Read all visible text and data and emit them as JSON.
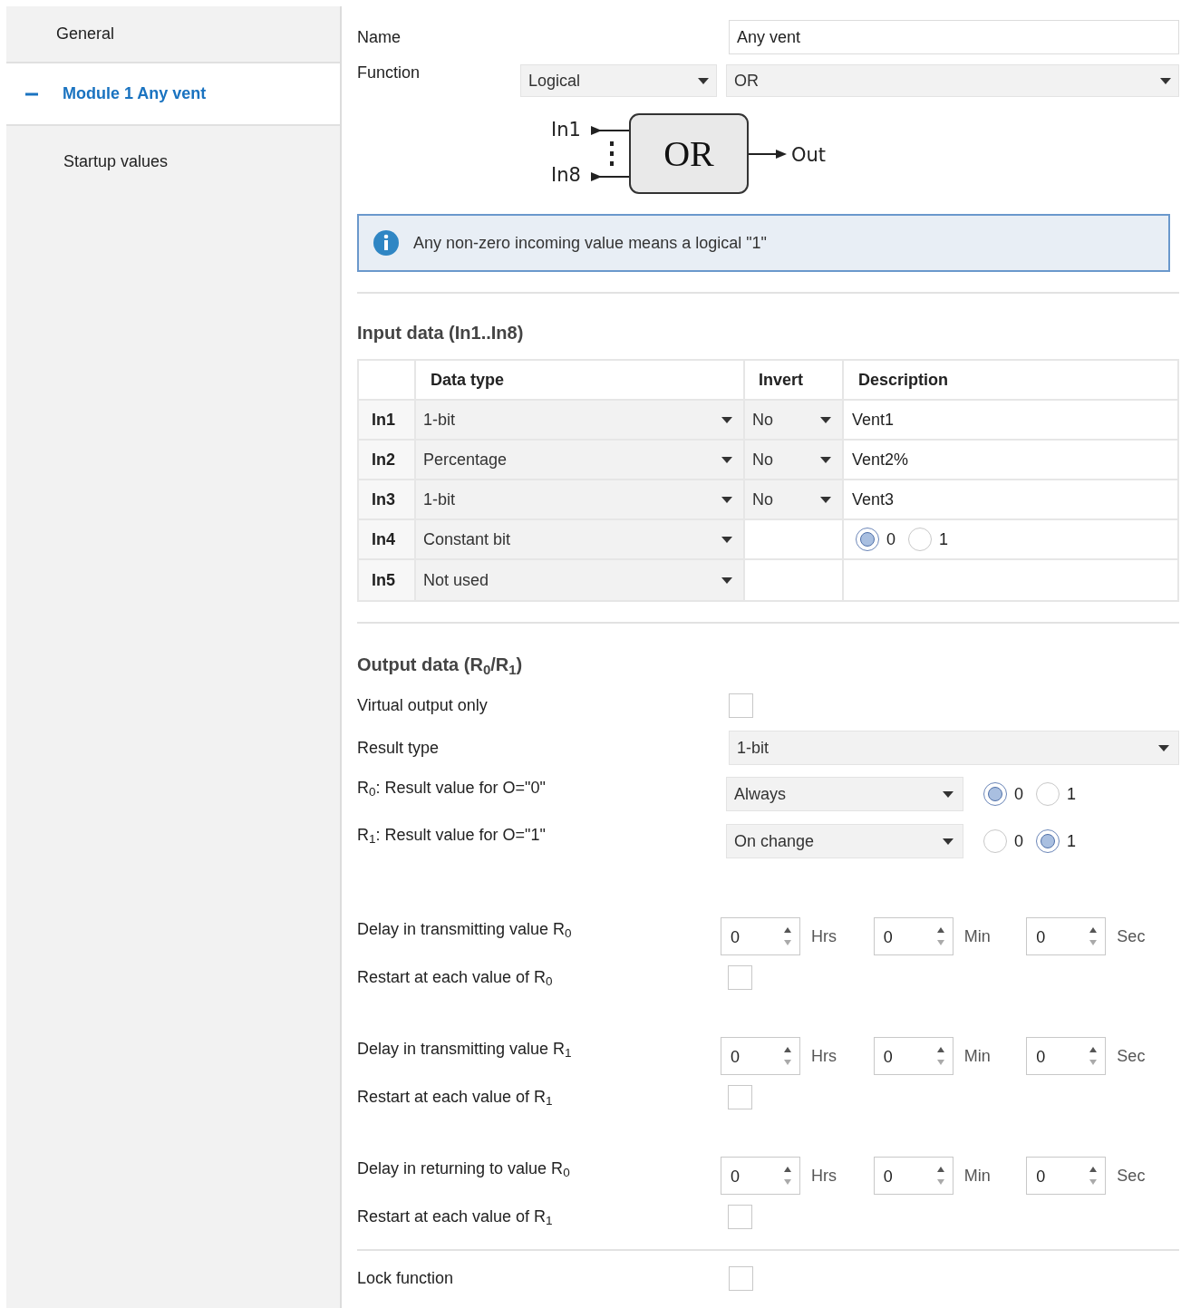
{
  "sidebar": {
    "items": [
      {
        "kind": "item",
        "label": "General",
        "selected": false
      },
      {
        "kind": "group",
        "label": "Module 1 Any vent",
        "selected": true,
        "expanded": true,
        "children": [
          {
            "kind": "item",
            "label": "Startup values",
            "selected": false
          }
        ]
      }
    ]
  },
  "name": {
    "label": "Name",
    "value": "Any vent"
  },
  "function": {
    "label": "Function",
    "category": "Logical",
    "operation": "OR"
  },
  "diagram": {
    "input_first": "In1",
    "input_last": "In8",
    "gate": "OR",
    "output": "Out"
  },
  "info": "Any non-zero incoming value means a logical \"1\"",
  "input_data": {
    "title": "Input data (In1..In8)",
    "columns": [
      "Data type",
      "Invert",
      "Description"
    ],
    "rows": [
      {
        "kind": "text",
        "label": "In1",
        "data_type": "1-bit",
        "invert": "No",
        "description": "Vent1"
      },
      {
        "kind": "text",
        "label": "In2",
        "data_type": "Percentage",
        "invert": "No",
        "description": "Vent2%"
      },
      {
        "kind": "text",
        "label": "In3",
        "data_type": "1-bit",
        "invert": "No",
        "description": "Vent3"
      },
      {
        "kind": "constant",
        "label": "In4",
        "data_type": "Constant bit",
        "options": [
          {
            "label": "0",
            "selected": true
          },
          {
            "label": "1",
            "selected": false
          }
        ]
      },
      {
        "kind": "unused",
        "label": "In5",
        "data_type": "Not used"
      }
    ]
  },
  "output_data": {
    "title": "Output data (R$_{0}$/R$_{1}$)",
    "virtual_output": {
      "label": "Virtual output only",
      "checked": false
    },
    "result_type": {
      "label": "Result type",
      "value": "1-bit"
    },
    "result_values": [
      {
        "label": "R$_{0}$: Result value for O=\"0\"",
        "mode": "Always",
        "options": [
          {
            "label": "0",
            "selected": true
          },
          {
            "label": "1",
            "selected": false
          }
        ]
      },
      {
        "label": "R$_{1}$: Result value for O=\"1\"",
        "mode": "On change",
        "options": [
          {
            "label": "0",
            "selected": false
          },
          {
            "label": "1",
            "selected": true
          }
        ]
      }
    ],
    "delays": [
      {
        "label": "Delay in transmitting value R$_{0}$",
        "fields": [
          {
            "value": "0",
            "unit": "Hrs"
          },
          {
            "value": "0",
            "unit": "Min"
          },
          {
            "value": "0",
            "unit": "Sec"
          }
        ],
        "restart": {
          "label": "Restart at each value of R$_{0}$",
          "checked": false
        }
      },
      {
        "label": "Delay in transmitting value R$_{1}$",
        "fields": [
          {
            "value": "0",
            "unit": "Hrs"
          },
          {
            "value": "0",
            "unit": "Min"
          },
          {
            "value": "0",
            "unit": "Sec"
          }
        ],
        "restart": {
          "label": "Restart at each value of R$_{1}$",
          "checked": false
        }
      },
      {
        "label": "Delay in returning to value R$_{0}$",
        "fields": [
          {
            "value": "0",
            "unit": "Hrs"
          },
          {
            "value": "0",
            "unit": "Min"
          },
          {
            "value": "0",
            "unit": "Sec"
          }
        ],
        "restart": {
          "label": "Restart at each value of R$_{1}$",
          "checked": false
        }
      }
    ],
    "lock": {
      "label": "Lock function",
      "checked": false
    }
  }
}
